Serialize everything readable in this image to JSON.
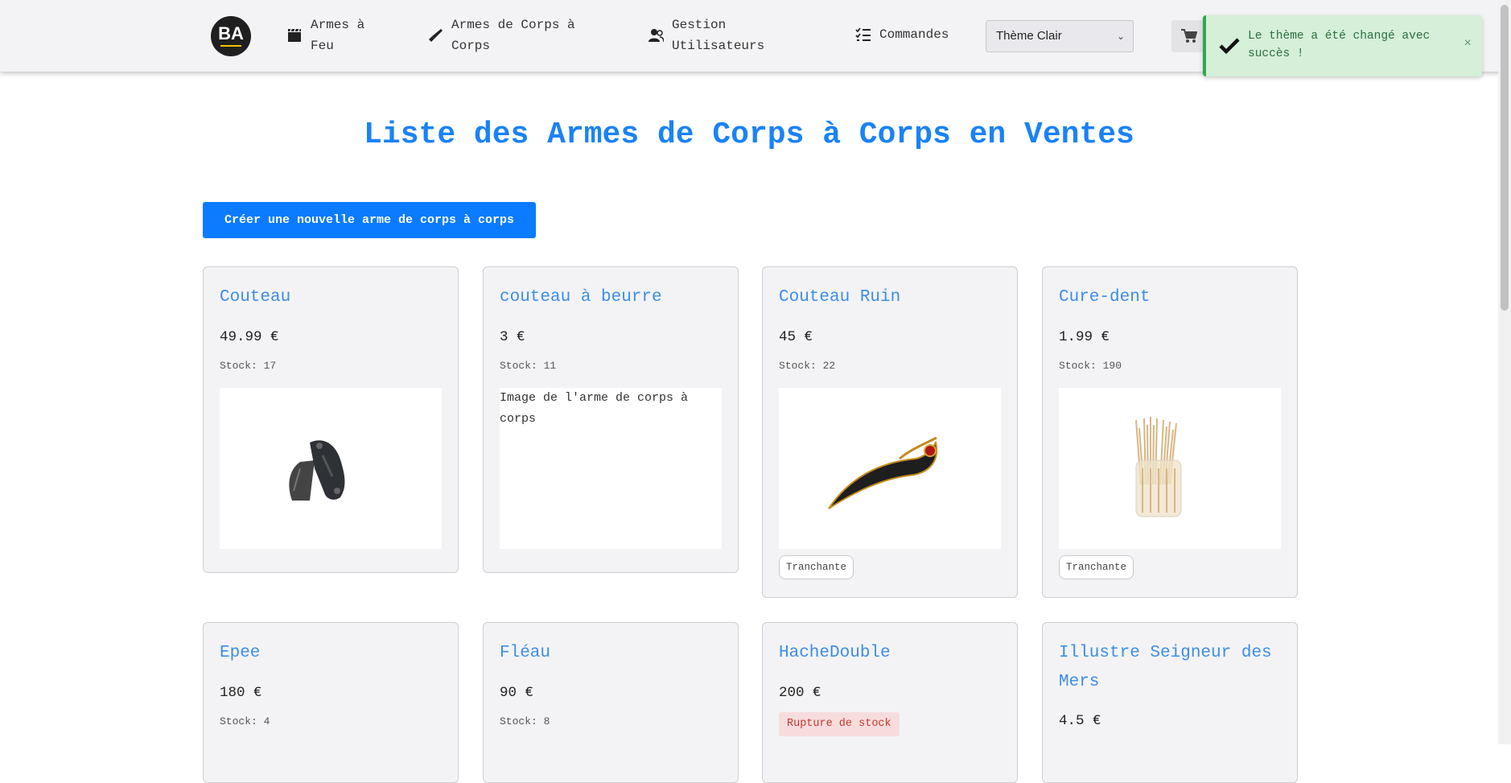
{
  "navbar": {
    "logo_text": "BA",
    "items": [
      {
        "label": "Armes à Feu",
        "icon": "clapperboard-icon"
      },
      {
        "label": "Armes de Corps à Corps",
        "icon": "blade-icon"
      },
      {
        "label": "Gestion Utilisateurs",
        "icon": "users-icon"
      },
      {
        "label": "Commandes",
        "icon": "list-check-icon"
      }
    ],
    "theme_select": {
      "selected": "Thème Clair"
    },
    "cart_icon": "cart-icon"
  },
  "toast": {
    "message": "Le thème a été changé avec succès !",
    "close": "×",
    "color": "#2fa84f"
  },
  "main": {
    "title": "Liste des Armes de Corps à Corps en Ventes",
    "create_button": "Créer une nouvelle arme de corps à corps",
    "stock_prefix": "Stock: ",
    "accent_color": "#1a82f7",
    "products": [
      {
        "name": "Couteau",
        "price": "49.99 €",
        "stock": "Stock: 17",
        "image": "folding-knife",
        "tag": ""
      },
      {
        "name": "couteau à beurre",
        "price": "3 €",
        "stock": "Stock: 11",
        "image": "broken",
        "image_alt": "Image de l'arme de corps à corps",
        "tag": ""
      },
      {
        "name": "Couteau Ruin",
        "price": "45 €",
        "stock": "Stock: 22",
        "image": "curved-dagger",
        "tag": "Tranchante"
      },
      {
        "name": "Cure-dent",
        "price": "1.99 €",
        "stock": "Stock: 190",
        "image": "toothpicks-jar",
        "tag": "Tranchante"
      },
      {
        "name": "Epee",
        "price": "180 €",
        "stock": "Stock: 4"
      },
      {
        "name": "Fléau",
        "price": "90 €",
        "stock": "Stock: 8"
      },
      {
        "name": "HacheDouble",
        "price": "200 €",
        "status": "Rupture de stock"
      },
      {
        "name": "Illustre Seigneur des Mers",
        "price": "4.5 €"
      }
    ]
  }
}
